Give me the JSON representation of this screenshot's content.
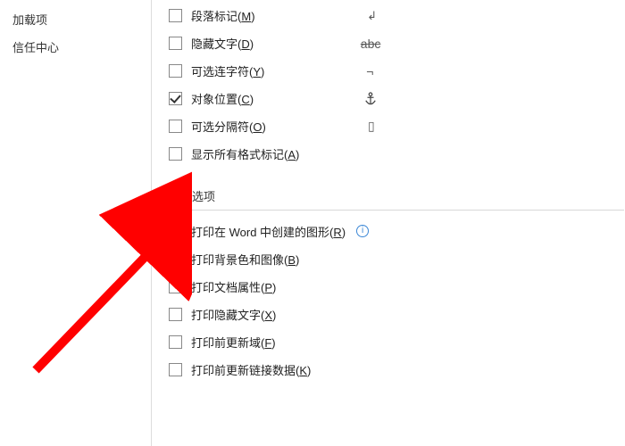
{
  "sidebar": {
    "items": [
      {
        "label": "加载项"
      },
      {
        "label": "信任中心"
      }
    ]
  },
  "display_options": [
    {
      "label": "段落标记",
      "key": "M",
      "checked": false,
      "icon": "paragraph-icon"
    },
    {
      "label": "隐藏文字",
      "key": "D",
      "checked": false,
      "icon": "strike-abc-icon"
    },
    {
      "label": "可选连字符",
      "key": "Y",
      "checked": false,
      "icon": "hyphen-icon"
    },
    {
      "label": "对象位置",
      "key": "C",
      "checked": true,
      "icon": "anchor-icon"
    },
    {
      "label": "可选分隔符",
      "key": "O",
      "checked": false,
      "icon": "separator-icon"
    },
    {
      "label": "显示所有格式标记",
      "key": "A",
      "checked": false,
      "icon": ""
    }
  ],
  "print_section_title": "打印选项",
  "print_options": [
    {
      "label": "打印在 Word 中创建的图形",
      "key": "R",
      "checked": true,
      "info": true
    },
    {
      "label": "打印背景色和图像",
      "key": "B",
      "checked": true,
      "blue": true
    },
    {
      "label": "打印文档属性",
      "key": "P",
      "checked": false
    },
    {
      "label": "打印隐藏文字",
      "key": "X",
      "checked": false
    },
    {
      "label": "打印前更新域",
      "key": "F",
      "checked": false
    },
    {
      "label": "打印前更新链接数据",
      "key": "K",
      "checked": false
    }
  ],
  "icon_chars": {
    "paragraph-icon": "↵",
    "hyphen-icon": "¬",
    "separator-icon": "▯"
  }
}
